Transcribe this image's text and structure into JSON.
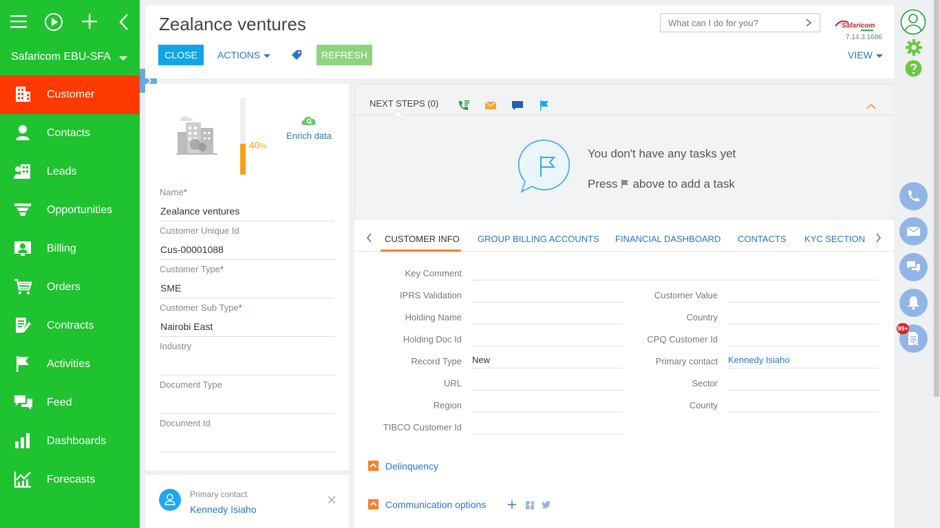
{
  "sidebar": {
    "org_name": "Safaricom EBU-SFA",
    "items": [
      {
        "label": "Customer",
        "icon": "building-icon",
        "active": true
      },
      {
        "label": "Contacts",
        "icon": "person-icon"
      },
      {
        "label": "Leads",
        "icon": "leads-icon"
      },
      {
        "label": "Opportunities",
        "icon": "funnel-icon"
      },
      {
        "label": "Billing",
        "icon": "billing-icon"
      },
      {
        "label": "Orders",
        "icon": "cart-icon"
      },
      {
        "label": "Contracts",
        "icon": "contract-icon"
      },
      {
        "label": "Activities",
        "icon": "flag-icon"
      },
      {
        "label": "Feed",
        "icon": "feed-icon"
      },
      {
        "label": "Dashboards",
        "icon": "bar-chart-icon"
      },
      {
        "label": "Forecasts",
        "icon": "forecast-icon"
      }
    ],
    "accent": "#1fc22f",
    "active_color": "#ff3a00"
  },
  "header": {
    "title": "Zealance ventures",
    "close_label": "CLOSE",
    "actions_label": "ACTIONS",
    "refresh_label": "REFRESH",
    "search_placeholder": "What can I do for you?",
    "logo_text": "Safaricom",
    "version": "7.14.3.1686",
    "view_label": "VIEW"
  },
  "profile": {
    "completeness_pct": 40,
    "completeness_text": "40",
    "completeness_unit": "%",
    "enrich_label": "Enrich data",
    "fields": [
      {
        "label": "Name",
        "required": true,
        "value": "Zealance ventures"
      },
      {
        "label": "Customer Unique Id",
        "required": false,
        "value": "Cus-00001088"
      },
      {
        "label": "Customer Type",
        "required": true,
        "value": "SME"
      },
      {
        "label": "Customer Sub Type",
        "required": true,
        "value": "Nairobi East"
      },
      {
        "label": "Industry",
        "required": false,
        "value": ""
      },
      {
        "label": "Document Type",
        "required": false,
        "value": ""
      },
      {
        "label": "Document Id",
        "required": false,
        "value": ""
      }
    ]
  },
  "primary_contact_card": {
    "label": "Primary contact",
    "value": "Kennedy Isiaho"
  },
  "next_steps": {
    "tab_label": "NEXT STEPS (0)",
    "empty_line1": "You don't have any tasks yet",
    "empty_press": "Press",
    "empty_after": "above to add a task"
  },
  "info": {
    "tabs": [
      "CUSTOMER INFO",
      "GROUP BILLING ACCOUNTS",
      "FINANCIAL DASHBOARD",
      "CONTACTS",
      "KYC SECTION"
    ],
    "key_comment_label": "Key Comment",
    "left_fields": [
      {
        "label": "IPRS Validation",
        "value": ""
      },
      {
        "label": "Holding Name",
        "value": ""
      },
      {
        "label": "Holding Doc Id",
        "value": ""
      },
      {
        "label": "Record Type",
        "value": "New"
      },
      {
        "label": "URL",
        "value": ""
      },
      {
        "label": "Region",
        "value": ""
      },
      {
        "label": "TIBCO Customer Id",
        "value": ""
      }
    ],
    "right_fields": [
      {
        "label": "Customer Value",
        "value": ""
      },
      {
        "label": "Country",
        "value": ""
      },
      {
        "label": "CPQ Customer Id",
        "value": ""
      },
      {
        "label": "Primary contact",
        "value": "Kennedy Isiaho"
      },
      {
        "label": "Sector",
        "value": ""
      },
      {
        "label": "County",
        "value": ""
      }
    ],
    "sections": [
      "Delinquency",
      "Communication options"
    ]
  },
  "rail": {
    "badge": "99+"
  }
}
